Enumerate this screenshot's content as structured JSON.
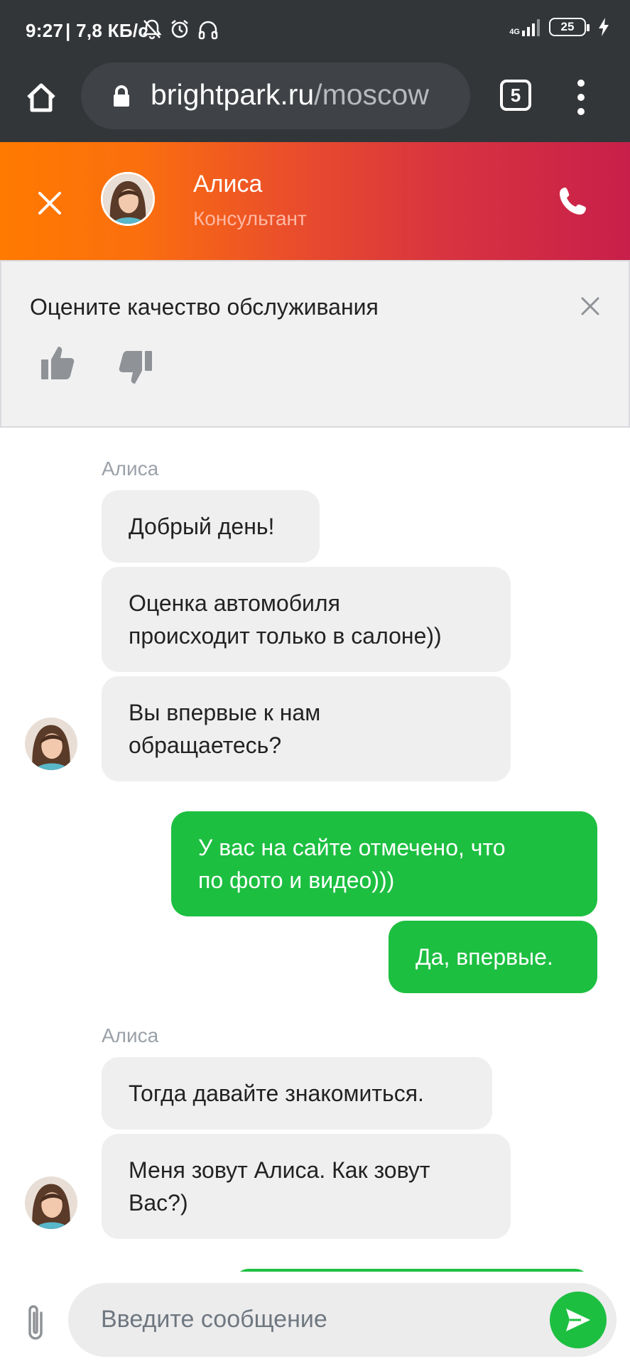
{
  "status_bar": {
    "time": "9:27",
    "net_speed": "| 7,8 КБ/с",
    "network": "4G",
    "battery": "25"
  },
  "browser": {
    "url_host": "brightpark.ru",
    "url_path": "/moscow",
    "tabs_count": "5"
  },
  "chat_header": {
    "name": "Алиса",
    "role": "Консультант"
  },
  "rating": {
    "title": "Оцените качество обслуживания"
  },
  "messages": [
    {
      "sender": "Алиса"
    },
    {
      "text": "Добрый день!"
    },
    {
      "text": "Оценка автомобиля\nпроисходит только в салоне))"
    },
    {
      "text": "Вы впервые к нам\nобращаетесь?"
    },
    {
      "text": "У вас на сайте отмечено, что\nпо фото и видео)))"
    },
    {
      "text": "Да, впервые."
    },
    {
      "sender": "Алиса"
    },
    {
      "text": "Тогда давайте знакомиться."
    },
    {
      "text": "Меня зовут Алиса. Как зовут\nВас?)"
    }
  ],
  "composer": {
    "placeholder": "Введите сообщение"
  },
  "colors": {
    "incoming_bubble": "#efeff0",
    "outgoing_bubble": "#1dbf41",
    "header_gradient_start": "#ff7a00",
    "header_gradient_end": "#c81f4a"
  }
}
